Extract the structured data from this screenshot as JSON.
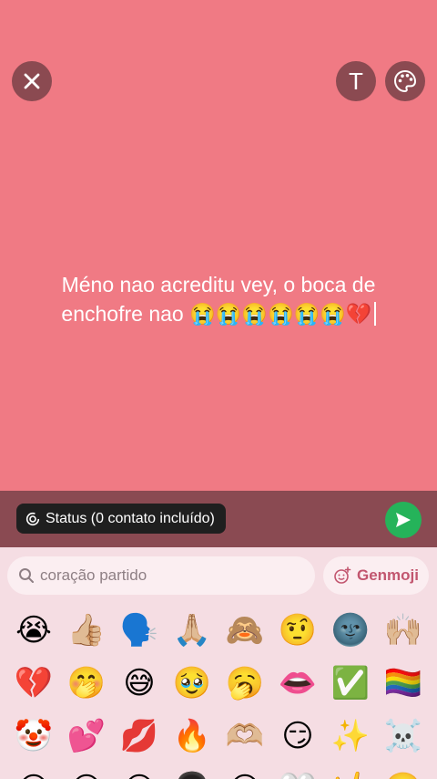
{
  "top_bar": {
    "close_icon": "close-icon",
    "text_button_label": "T",
    "palette_icon": "palette-icon"
  },
  "status_text": {
    "line1": "Méno nao acreditu vey, o boca de",
    "line2": "enchofre nao 😭😭😭😭😭😭💔"
  },
  "compose": {
    "audience_label": "Status (0 contato incluído)",
    "send_icon": "send-icon"
  },
  "keyboard": {
    "search_placeholder": "coração partido",
    "genmoji_label": "Genmoji",
    "emoji_rows": [
      [
        "😭",
        "👍🏼",
        "🗣️",
        "🙏🏼",
        "🙈",
        "🤨",
        "🌚",
        "🙌🏼"
      ],
      [
        "💔",
        "🤭",
        "😅",
        "🥹",
        "🥱",
        "👄",
        "✅",
        "🏳️‍🌈"
      ],
      [
        "🤡",
        "💕",
        "💋",
        "🔥",
        "🫶🏼",
        "😏",
        "✨",
        "☠️"
      ],
      [
        "😊",
        "😐",
        "😶",
        "👩🏿",
        "😶",
        "🤍",
        "🤟",
        "🥲"
      ]
    ]
  },
  "colors": {
    "background": "#f07a84",
    "compose_bar": "#8a4a52",
    "send_button": "#25b35a",
    "keyboard": "#f5dde3",
    "genmoji_text": "#c2566f"
  }
}
